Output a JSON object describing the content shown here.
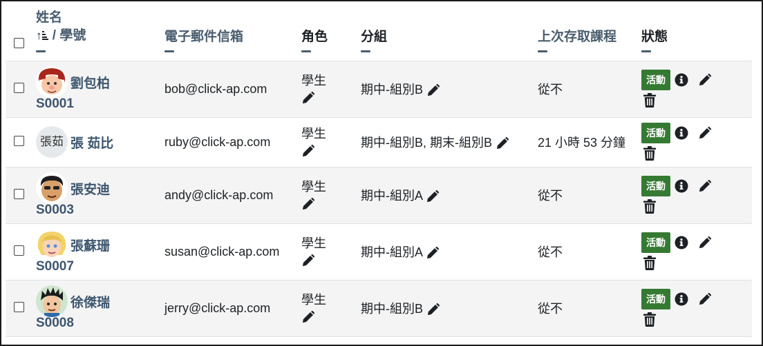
{
  "header": {
    "name_label": "姓名",
    "sort_arrow": "↑",
    "id_label": "/ 學號",
    "email_label": "電子郵件信箱",
    "role_label": "角色",
    "group_label": "分組",
    "last_access_label": "上次存取課程",
    "status_label": "狀態"
  },
  "rows": [
    {
      "name": "劉包柏",
      "id": "S0001",
      "email": "bob@click-ap.com",
      "role": "學生",
      "group": "期中-組別B",
      "last_access": "從不",
      "status": "活動",
      "avatar": "cartoon-red-hair",
      "avatar_text": ""
    },
    {
      "name": "張 茹比",
      "id": "",
      "email": "ruby@click-ap.com",
      "role": "學生",
      "group": "期中-組別B, 期末-組別B",
      "last_access": "21 小時 53 分鐘",
      "status": "活動",
      "avatar": "initials",
      "avatar_text": "張茹"
    },
    {
      "name": "張安迪",
      "id": "S0003",
      "email": "andy@click-ap.com",
      "role": "學生",
      "group": "期中-組別A",
      "last_access": "從不",
      "status": "活動",
      "avatar": "cartoon-dark-hair",
      "avatar_text": ""
    },
    {
      "name": "張蘇珊",
      "id": "S0007",
      "email": "susan@click-ap.com",
      "role": "學生",
      "group": "期中-組別A",
      "last_access": "從不",
      "status": "活動",
      "avatar": "cartoon-blonde",
      "avatar_text": ""
    },
    {
      "name": "徐傑瑞",
      "id": "S0008",
      "email": "jerry@click-ap.com",
      "role": "學生",
      "group": "期中-組別B",
      "last_access": "從不",
      "status": "活動",
      "avatar": "cartoon-spiky",
      "avatar_text": ""
    }
  ],
  "colors": {
    "badge": "#357a32",
    "link": "#3d566e",
    "stripe": "#f4f4f4"
  }
}
